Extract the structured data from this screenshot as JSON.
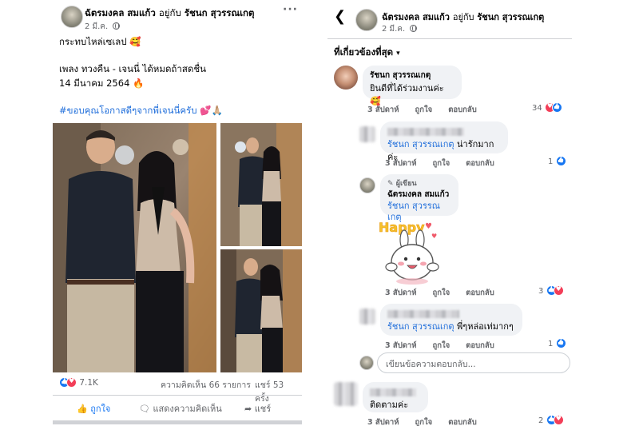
{
  "post": {
    "author": "ฉัตรมงคล สมแก้ว",
    "with_word": "อยู่กับ",
    "tagged": "รัชนก สุวรรณเกตุ",
    "date": "2 มี.ค.",
    "more_icon": "more-dots-icon",
    "caption_line1": "กระทบไหล่เซเลป 🥰",
    "caption_line2": "เพลง ทวงคืน - เจนนี่ ได้หมดถ้าสดชื่น",
    "caption_line3": "14 มีนาคม 2564 🔥",
    "hashtag": "#ขอบคุณโอกาสดีๆจากพี่เจนนี่ครับ 💕🙏🏼",
    "reaction_count": "7.1K",
    "comments_count": "ความคิดเห็น 66 รายการ",
    "shares_count": "แชร์ 53 ครั้ง",
    "actions": {
      "like": "ถูกใจ",
      "comment": "แสดงความคิดเห็น",
      "share": "แชร์"
    }
  },
  "comments_view": {
    "author": "ฉัตรมงคล สมแก้ว",
    "with_word": "อยู่กับ",
    "tagged": "รัชนก สุวรรณเกตุ",
    "date": "2 มี.ค.",
    "sort_label": "ที่เกี่ยวข้องที่สุด",
    "comments": [
      {
        "name": "รัชนก สุวรรณเกตุ",
        "text": "ยินดีที่ได้ร่วมงานค่ะ🥰",
        "time": "3 สัปดาห์",
        "like": "ถูกใจ",
        "reply": "ตอบกลับ",
        "reactions": "34"
      },
      {
        "mention": "รัชนก สุวรรณเกตุ",
        "text": "น่ารักมากค่ะ",
        "time": "3 สัปดาห์",
        "like": "ถูกใจ",
        "reply": "ตอบกลับ",
        "reactions": "1"
      },
      {
        "badge": "ผู้เขียน",
        "name": "ฉัตรมงคล สมแก้ว",
        "mention": "รัชนก สุวรรณเกตุ",
        "sticker_text": "Happy",
        "time": "3 สัปดาห์",
        "like": "ถูกใจ",
        "reply": "ตอบกลับ",
        "reactions": "3"
      },
      {
        "mention": "รัชนก สุวรรณเกตุ",
        "text": "พี่ๆหล่อเท่มากๆ",
        "time": "3 สัปดาห์",
        "like": "ถูกใจ",
        "reply": "ตอบกลับ",
        "reactions": "1"
      },
      {
        "text": "ติดตามค่ะ",
        "time": "3 สัปดาห์",
        "like": "ถูกใจ",
        "reply": "ตอบกลับ",
        "reactions": "2"
      }
    ],
    "reply_placeholder": "เขียนข้อความตอบกลับ..."
  },
  "colors": {
    "link_blue": "#216fdb",
    "like_blue": "#1877f2",
    "love_red": "#f33e58",
    "bubble_gray": "#f0f2f5",
    "meta_gray": "#65676b"
  }
}
